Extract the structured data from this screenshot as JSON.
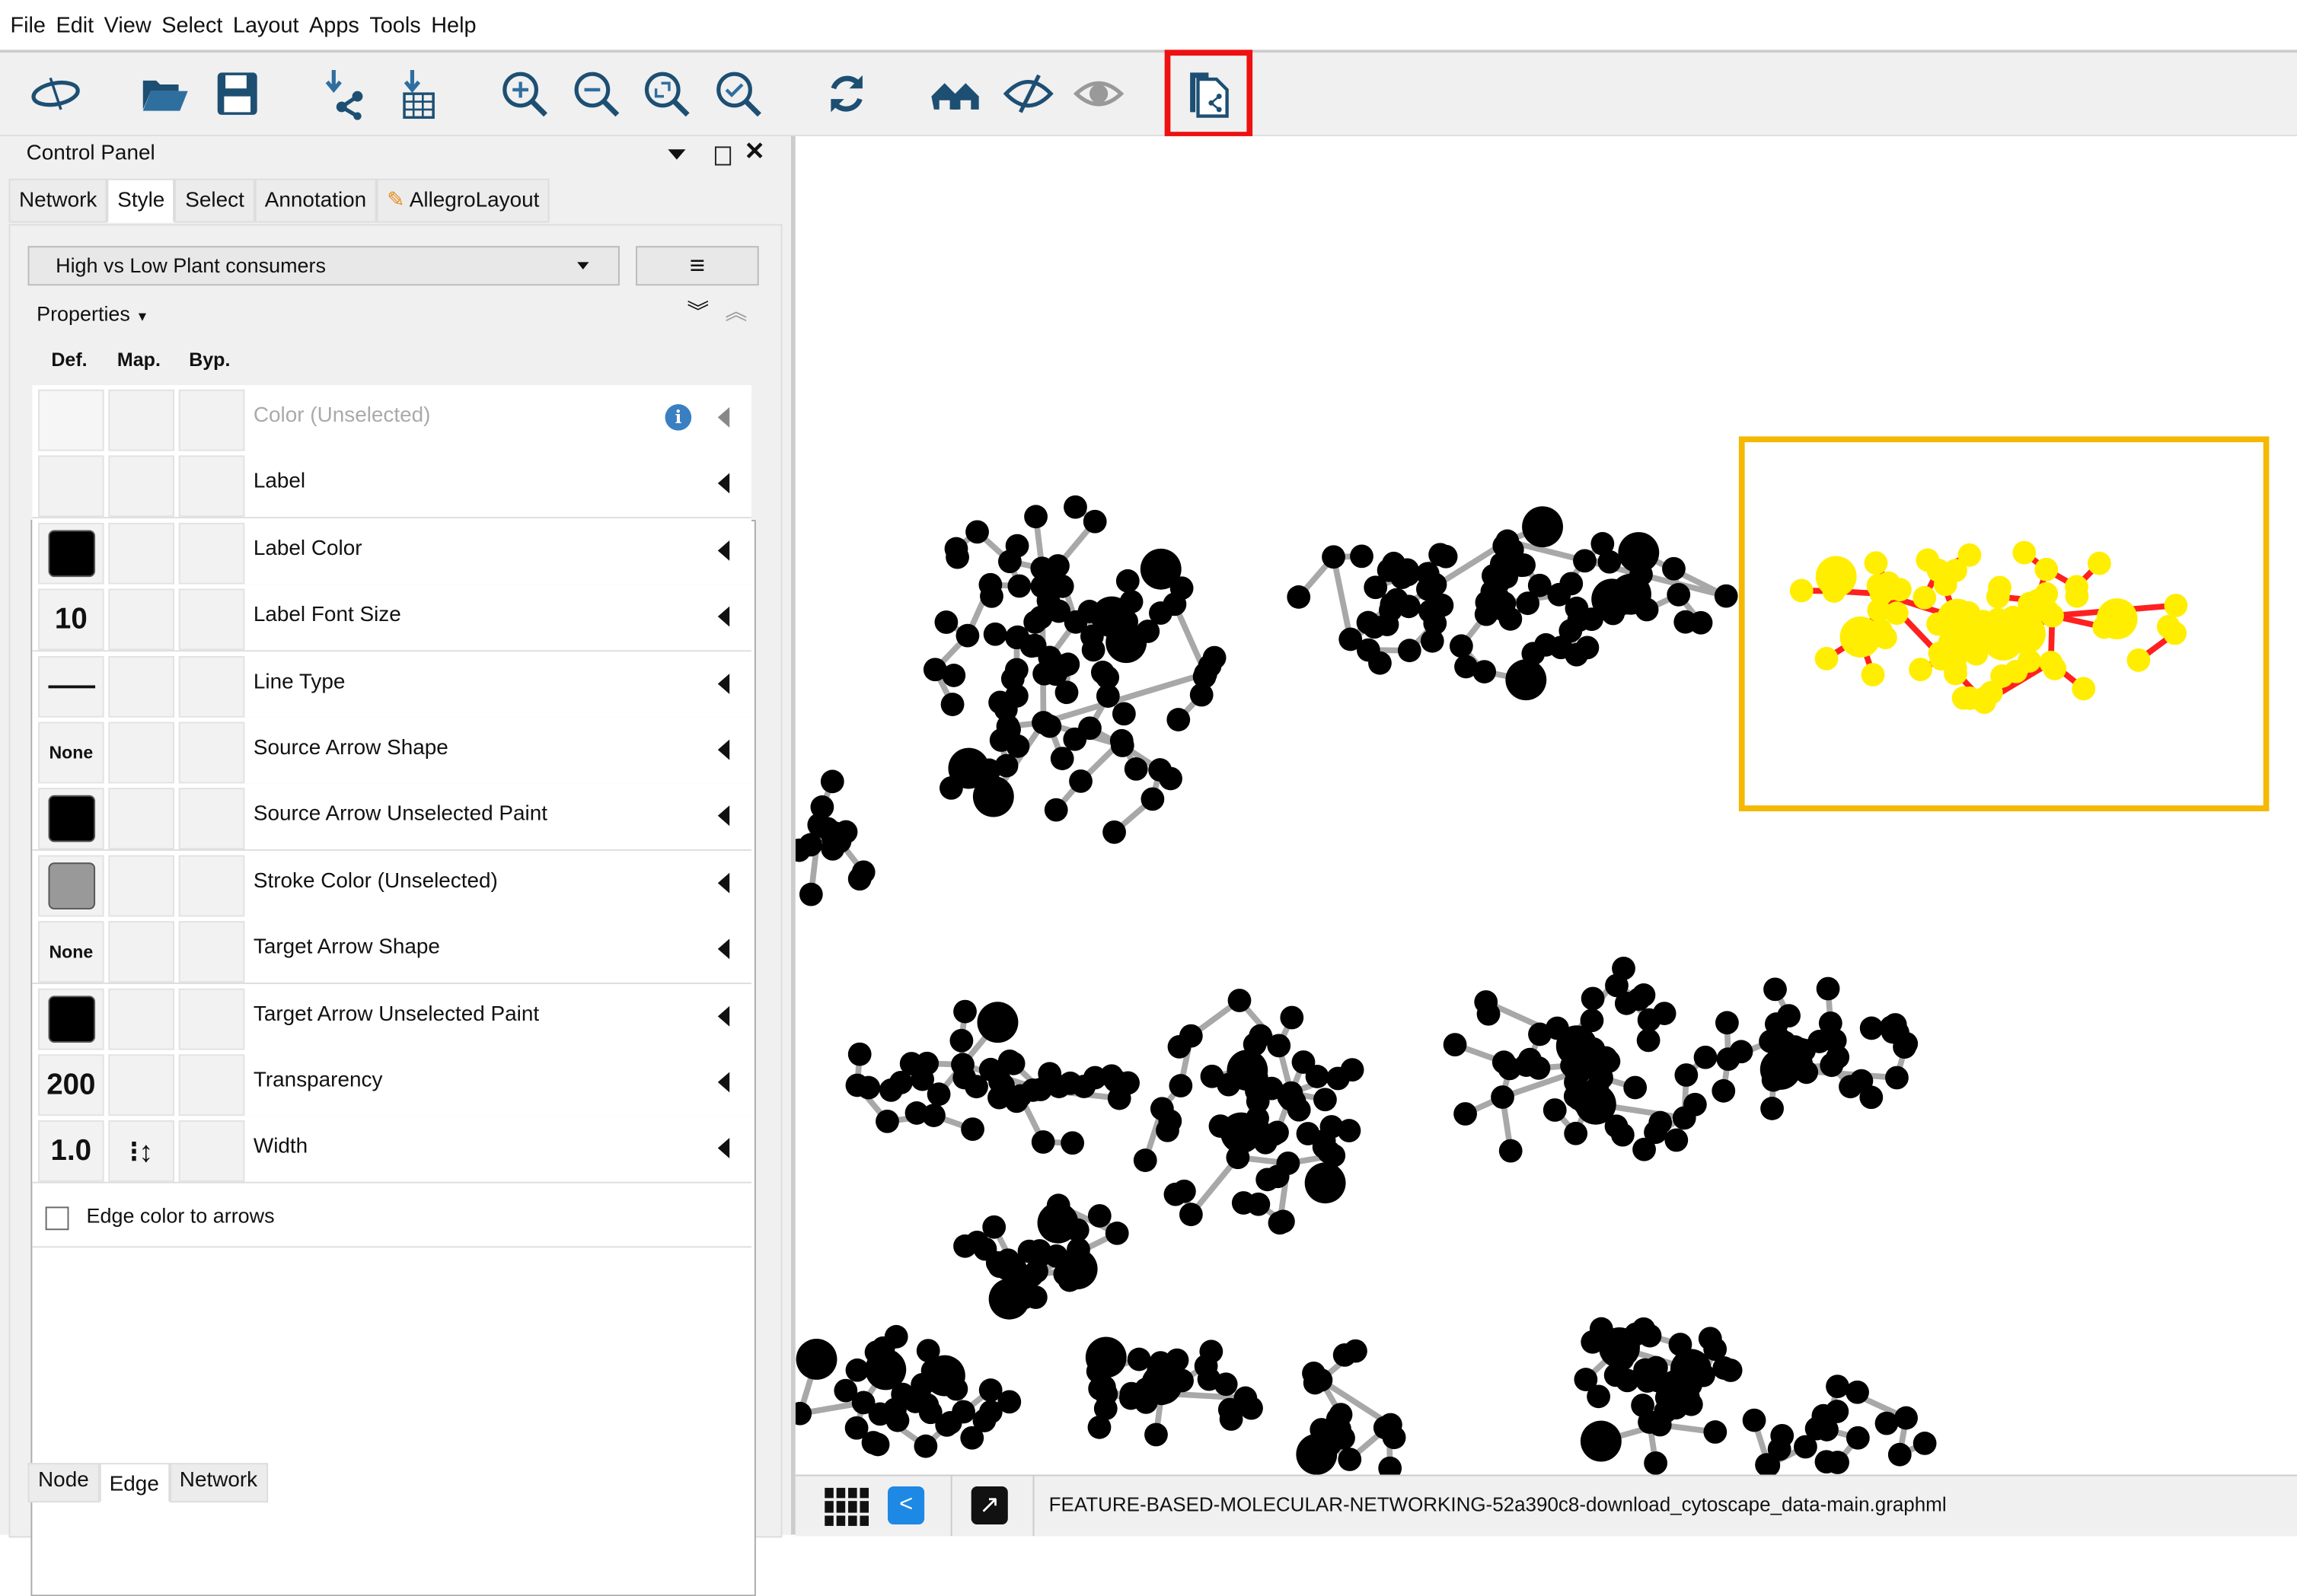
{
  "menu": [
    "File",
    "Edit",
    "View",
    "Select",
    "Layout",
    "Apps",
    "Tools",
    "Help"
  ],
  "toolbar": {
    "icons": [
      "cytoscape-logo-icon",
      "open-folder-icon",
      "save-icon",
      "import-network-icon",
      "import-table-icon",
      "zoom-in-icon",
      "zoom-out-icon",
      "zoom-fit-icon",
      "zoom-selected-icon",
      "refresh-icon",
      "home-icon",
      "hide-icon",
      "show-icon",
      "new-network-from-selection-icon"
    ],
    "highlight_color": "#ee1111"
  },
  "control_panel": {
    "title": "Control Panel",
    "tabs": [
      "Network",
      "Style",
      "Select",
      "Annotation",
      "AllegroLayout"
    ],
    "active_tab": "Style",
    "style_select": "High vs Low Plant consumers",
    "properties_label": "Properties",
    "columns": [
      "Def.",
      "Map.",
      "Byp."
    ],
    "rows": [
      {
        "label": "Color (Unselected)",
        "def": "",
        "disabled": true
      },
      {
        "label": "Label",
        "def": ""
      },
      {
        "label": "Label Color",
        "def": "swatch-black"
      },
      {
        "label": "Label Font Size",
        "def": "10"
      },
      {
        "label": "Line Type",
        "def": "line"
      },
      {
        "label": "Source Arrow Shape",
        "def": "None"
      },
      {
        "label": "Source Arrow Unselected Paint",
        "def": "swatch-black"
      },
      {
        "label": "Stroke Color (Unselected)",
        "def": "swatch-gray"
      },
      {
        "label": "Target Arrow Shape",
        "def": "None"
      },
      {
        "label": "Target Arrow Unselected Paint",
        "def": "swatch-black"
      },
      {
        "label": "Transparency",
        "def": "200"
      },
      {
        "label": "Width",
        "def": "1.0",
        "map": "continuous-mapping-icon"
      }
    ],
    "edge_color_to_arrows": "Edge color to arrows",
    "edge_color_checked": false,
    "bottom_tabs": [
      "Node",
      "Edge",
      "Network"
    ],
    "active_bottom_tab": "Edge"
  },
  "network": {
    "node_color": "#000000",
    "edge_color": "#a8a8a8",
    "selected_node_color": "#ffee00",
    "selected_edge_color": "#ff2020",
    "selection_box_color": "#f5b800"
  },
  "statusbar": {
    "filename": "FEATURE-BASED-MOLECULAR-NETWORKING-52a390c8-download_cytoscape_data-main.graphml"
  }
}
